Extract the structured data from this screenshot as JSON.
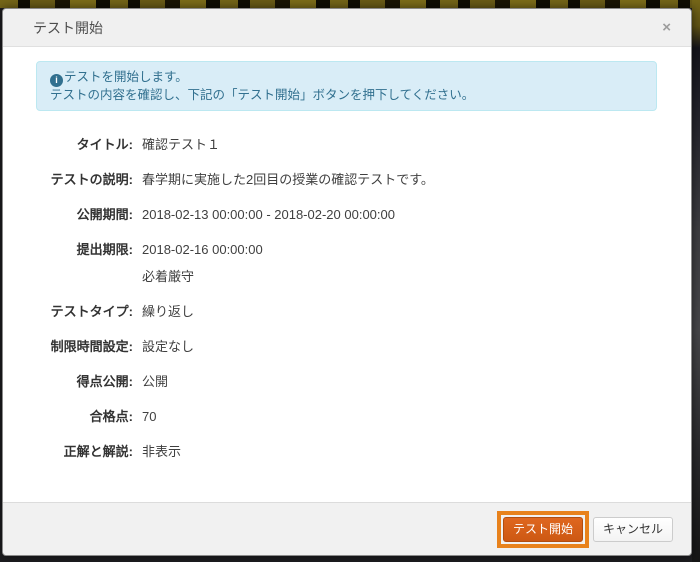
{
  "modal": {
    "title": "テスト開始",
    "close_glyph": "×",
    "alert": {
      "icon_glyph": "i",
      "line1": "テストを開始します。",
      "line2": "テストの内容を確認し、下記の「テスト開始」ボタンを押下してください。"
    },
    "fields": [
      {
        "key": "title",
        "label": "タイトル:",
        "values": [
          "確認テスト１"
        ]
      },
      {
        "key": "description",
        "label": "テストの説明:",
        "values": [
          "春学期に実施した2回目の授業の確認テストです。"
        ]
      },
      {
        "key": "open-period",
        "label": "公開期間:",
        "values": [
          "2018-02-13 00:00:00 - 2018-02-20 00:00:00"
        ]
      },
      {
        "key": "submit-deadline",
        "label": "提出期限:",
        "values": [
          "2018-02-16 00:00:00",
          "必着厳守"
        ]
      },
      {
        "key": "test-type",
        "label": "テストタイプ:",
        "values": [
          "繰り返し"
        ]
      },
      {
        "key": "time-limit",
        "label": "制限時間設定:",
        "values": [
          "設定なし"
        ]
      },
      {
        "key": "score-publish",
        "label": "得点公開:",
        "values": [
          "公開"
        ]
      },
      {
        "key": "passing-score",
        "label": "合格点:",
        "values": [
          "70"
        ]
      },
      {
        "key": "answer-explanation",
        "label": "正解と解説:",
        "values": [
          "非表示"
        ]
      }
    ],
    "footer": {
      "start_label": "テスト開始",
      "cancel_label": "キャンセル"
    }
  },
  "colors": {
    "highlight_border": "#E8821C",
    "start_button_bg": "#D45A15",
    "alert_bg": "#D9EDF7",
    "alert_border": "#BCE8F1",
    "alert_text": "#31708F",
    "header_bg": "#F0F0F0",
    "footer_bg": "#F1F1F1"
  }
}
